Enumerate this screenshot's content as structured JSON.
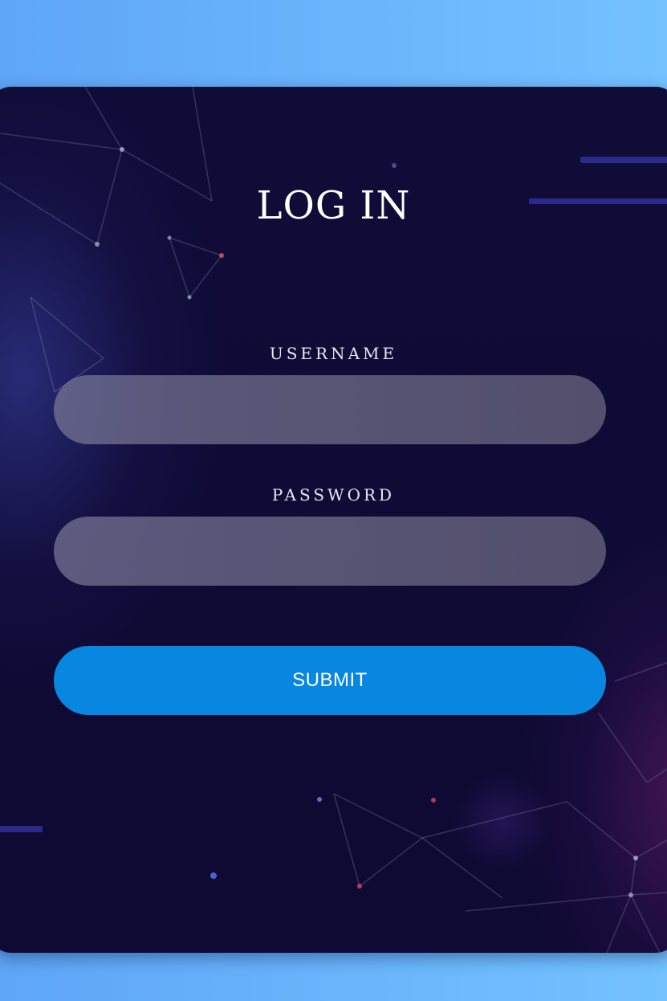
{
  "login": {
    "title": "LOG IN",
    "username_label": "USERNAME",
    "username_value": "",
    "password_label": "PASSWORD",
    "password_value": "",
    "submit_label": "SUBMIT"
  },
  "colors": {
    "page_background_start": "#5fa6f7",
    "page_background_end": "#73c2ff",
    "card_background": "#0f0a33",
    "input_fill": "#6b6884",
    "submit_button": "#0787df",
    "text": "#ffffff"
  }
}
